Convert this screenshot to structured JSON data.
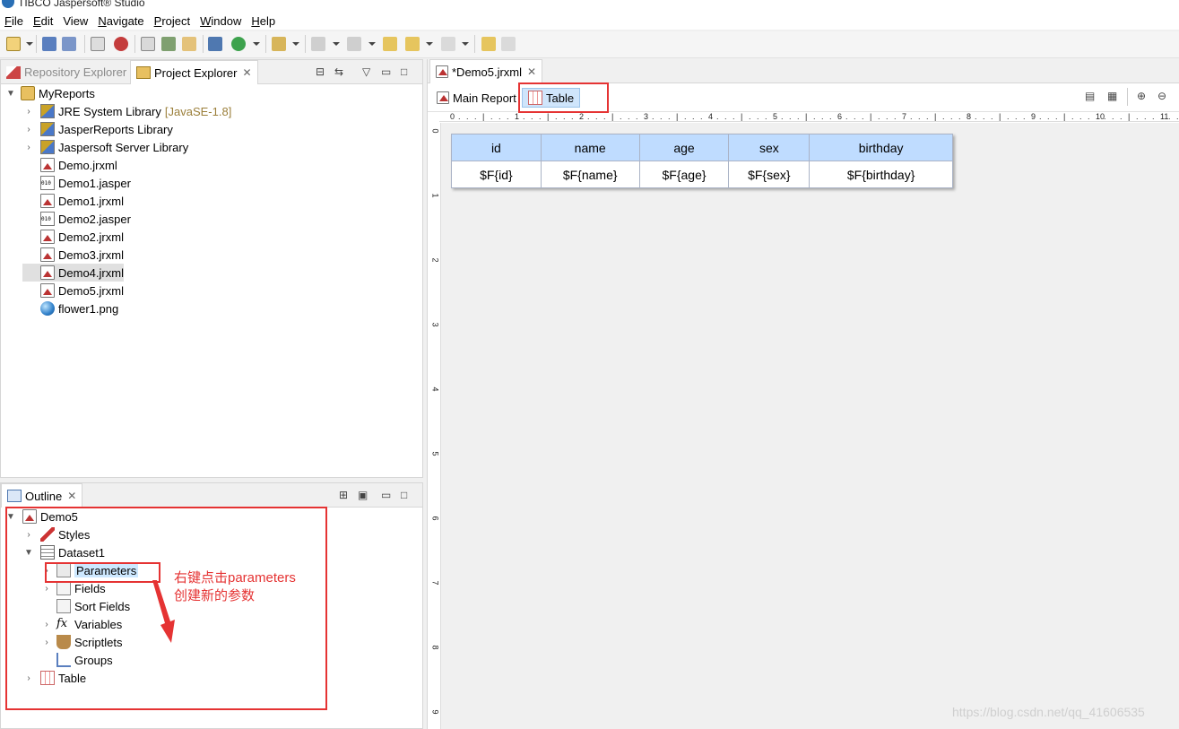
{
  "app": {
    "title": "TIBCO Jaspersoft® Studio"
  },
  "menu": [
    {
      "label": "File",
      "mnemonic": "F",
      "rest": "ile"
    },
    {
      "label": "Edit",
      "mnemonic": "E",
      "rest": "dit"
    },
    {
      "label": "View",
      "mnemonic": "",
      "rest": "View"
    },
    {
      "label": "Navigate",
      "mnemonic": "N",
      "rest": "avigate"
    },
    {
      "label": "Project",
      "mnemonic": "P",
      "rest": "roject"
    },
    {
      "label": "Window",
      "mnemonic": "W",
      "rest": "indow"
    },
    {
      "label": "Help",
      "mnemonic": "H",
      "rest": "elp"
    }
  ],
  "explorer": {
    "tab_repository": "Repository Explorer",
    "tab_project": "Project Explorer",
    "root": "MyReports",
    "items": [
      {
        "label": "JRE System Library",
        "suffix": "[JavaSE-1.8]",
        "type": "lib",
        "expandable": true
      },
      {
        "label": "JasperReports Library",
        "suffix": "",
        "type": "lib",
        "expandable": true
      },
      {
        "label": "Jaspersoft Server Library",
        "suffix": "",
        "type": "lib",
        "expandable": true
      },
      {
        "label": "Demo.jrxml",
        "suffix": "",
        "type": "jrxml",
        "expandable": false
      },
      {
        "label": "Demo1.jasper",
        "suffix": "",
        "type": "jasper",
        "expandable": false
      },
      {
        "label": "Demo1.jrxml",
        "suffix": "",
        "type": "jrxml",
        "expandable": false
      },
      {
        "label": "Demo2.jasper",
        "suffix": "",
        "type": "jasper",
        "expandable": false
      },
      {
        "label": "Demo2.jrxml",
        "suffix": "",
        "type": "jrxml",
        "expandable": false
      },
      {
        "label": "Demo3.jrxml",
        "suffix": "",
        "type": "jrxml",
        "expandable": false
      },
      {
        "label": "Demo4.jrxml",
        "suffix": "",
        "type": "jrxml",
        "expandable": false,
        "selected": true
      },
      {
        "label": "Demo5.jrxml",
        "suffix": "",
        "type": "jrxml",
        "expandable": false
      },
      {
        "label": "flower1.png",
        "suffix": "",
        "type": "png",
        "expandable": false
      }
    ]
  },
  "outline": {
    "tab": "Outline",
    "root": "Demo5",
    "styles": "Styles",
    "dataset": "Dataset1",
    "parameters": "Parameters",
    "fields": "Fields",
    "sort_fields": "Sort Fields",
    "variables": "Variables",
    "scriptlets": "Scriptlets",
    "groups": "Groups",
    "table": "Table"
  },
  "editor": {
    "tab": "*Demo5.jrxml",
    "main_report": "Main Report",
    "table_tab": "Table",
    "ruler_numbers": [
      "0",
      "1",
      "2",
      "3",
      "4",
      "5",
      "6",
      "7",
      "8",
      "9",
      "10",
      "11"
    ],
    "ruler_v_numbers": [
      "0",
      "1",
      "2",
      "3",
      "4",
      "5",
      "6",
      "7",
      "8",
      "9"
    ],
    "table": {
      "headers": [
        "id",
        "name",
        "age",
        "sex",
        "birthday"
      ],
      "row": [
        "$F{id}",
        "$F{name}",
        "$F{age}",
        "$F{sex}",
        "$F{birthday}"
      ]
    }
  },
  "annotation": {
    "line1": "右键点击parameters",
    "line2": "创建新的参数",
    "color": "#e53333"
  },
  "watermark": "https://blog.csdn.net/qq_41606535"
}
